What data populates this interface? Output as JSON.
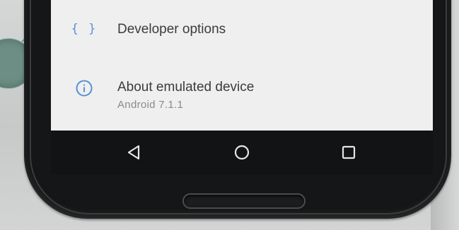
{
  "settings": {
    "developer_options": {
      "icon": "code-braces-icon",
      "icon_glyph": "{ }",
      "title": "Developer options"
    },
    "about_device": {
      "icon": "info-icon",
      "title": "About emulated device",
      "subtitle": "Android 7.1.1"
    }
  },
  "navbar": {
    "back_icon": "back-triangle-icon",
    "home_icon": "home-circle-icon",
    "recents_icon": "recents-square-icon"
  },
  "colors": {
    "accent_icon": "#5b8fd6",
    "screen_bg": "#efefef",
    "navbar_bg": "#121314",
    "phone_body": "#151617",
    "deco_teal": "#6c8e84"
  }
}
